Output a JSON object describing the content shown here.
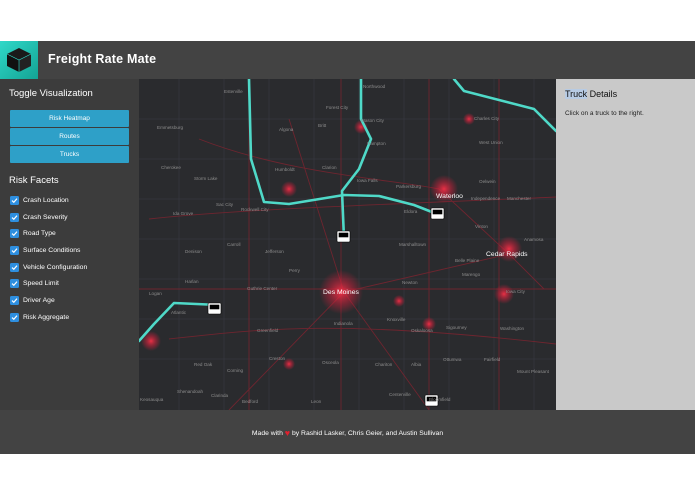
{
  "header": {
    "title": "Freight Rate Mate",
    "logo_icon": "cube-icon",
    "accent": "#26c6b4"
  },
  "sidebar": {
    "toggle_title": "Toggle Visualization",
    "toggles": [
      "Risk Heatmap",
      "Routes",
      "Trucks"
    ],
    "facets_title": "Risk Facets",
    "facets": [
      {
        "label": "Crash Location",
        "checked": true
      },
      {
        "label": "Crash Severity",
        "checked": true
      },
      {
        "label": "Road Type",
        "checked": true
      },
      {
        "label": "Surface Conditions",
        "checked": true
      },
      {
        "label": "Vehicle Configuration",
        "checked": true
      },
      {
        "label": "Speed Limit",
        "checked": true
      },
      {
        "label": "Driver Age",
        "checked": true
      },
      {
        "label": "Risk Aggregate",
        "checked": true
      }
    ],
    "button_color": "#2ea0c8",
    "checkbox_color": "#2e8fe0"
  },
  "map": {
    "main_city": "Des Moines",
    "labels": [
      "Esterville",
      "Northwood",
      "Forest City",
      "Mason City",
      "Charles City",
      "Emmetsburg",
      "Algona",
      "Britt",
      "Hampton",
      "West Union",
      "Cherokee",
      "Storm Lake",
      "Humboldt",
      "Clarion",
      "Iowa Falls",
      "Parkersburg",
      "Waterloo",
      "Oelwein",
      "Independence",
      "Manchester",
      "Ida Grove",
      "Sac City",
      "Rockwell City",
      "Eldora",
      "Vinton",
      "Anamosa",
      "Denison",
      "Carroll",
      "Jefferson",
      "Marshalltown",
      "Belle Plaine",
      "Cedar Rapids",
      "Harlan",
      "Guthrie Center",
      "Perry",
      "Newton",
      "Marengo",
      "Iowa City",
      "Logan",
      "Atlantic",
      "Greenfield",
      "Indianola",
      "Knoxville",
      "Oskaloosa",
      "Sigourney",
      "Washington",
      "Red Oak",
      "Corning",
      "Creston",
      "Osceola",
      "Chariton",
      "Albia",
      "Ottumwa",
      "Fairfield",
      "Mount Pleasant",
      "Shenandoah",
      "Clarinda",
      "Bedford",
      "Leon",
      "Centerville",
      "Bloomfield",
      "Keosauqua"
    ],
    "route_color": "#4fd9c8",
    "heat_color": "#e0243a"
  },
  "details": {
    "title_highlight": "Truck",
    "title_rest": " Details",
    "message": "Click on a truck to the right."
  },
  "footer": {
    "prefix": "Made with",
    "heart_icon": "heart-icon",
    "suffix": "by Rashid Lasker, Chris Geier, and Austin Sullivan"
  }
}
